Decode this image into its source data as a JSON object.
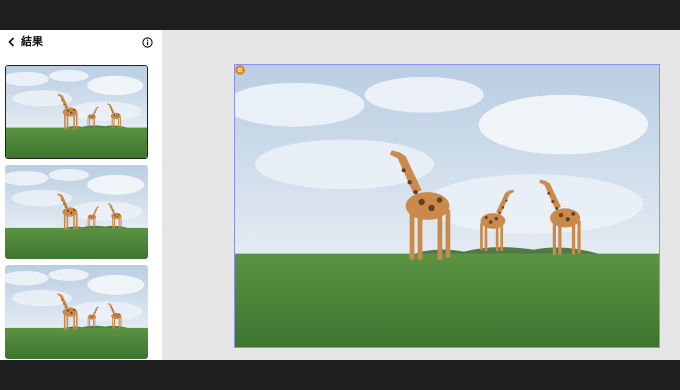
{
  "window": {
    "title": "結果"
  },
  "sidebar": {
    "back_icon": "chevron-left-icon",
    "title": "結果",
    "info_icon": "info-circle-icon",
    "thumbnails": [
      {
        "image": "giraffes-on-grassland",
        "selected": true
      },
      {
        "image": "giraffes-on-grassland",
        "selected": false
      },
      {
        "image": "giraffes-on-grassland",
        "selected": false
      }
    ]
  },
  "canvas": {
    "image": "giraffes-on-grassland",
    "badge_icon": "orange-marker-icon",
    "colors": {
      "selection_border": "#8f8ff0",
      "badge": "#e8891d",
      "sky": "#c8d9ea",
      "grass": "#4f8a3a"
    }
  }
}
